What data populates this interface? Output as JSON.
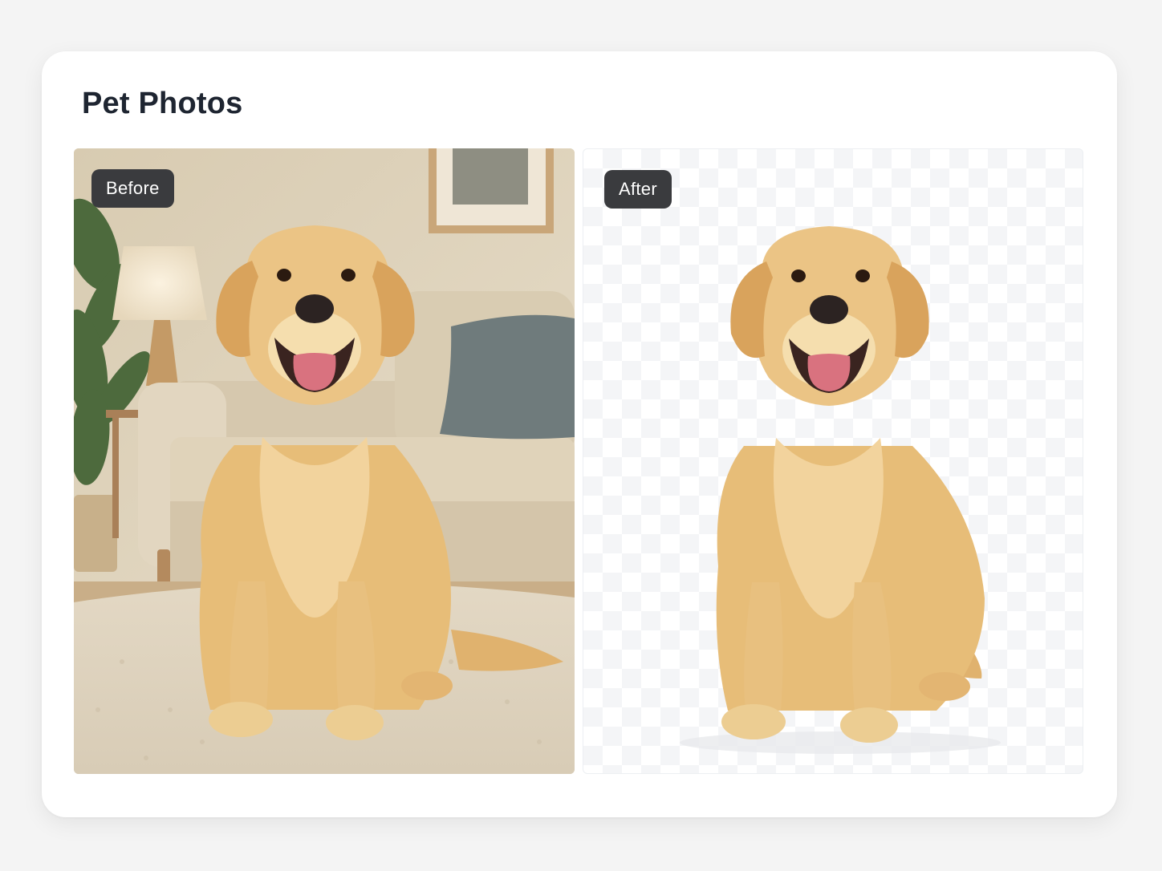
{
  "page": {
    "title": "Pet Photos"
  },
  "comparison": {
    "before": {
      "label": "Before",
      "image": "golden-retriever-in-living-room"
    },
    "after": {
      "label": "After",
      "image": "golden-retriever-background-removed"
    }
  },
  "colors": {
    "badge_background": "#3a3b3e",
    "title_text": "#1e2531",
    "dog_fur": "#e7bd78"
  }
}
